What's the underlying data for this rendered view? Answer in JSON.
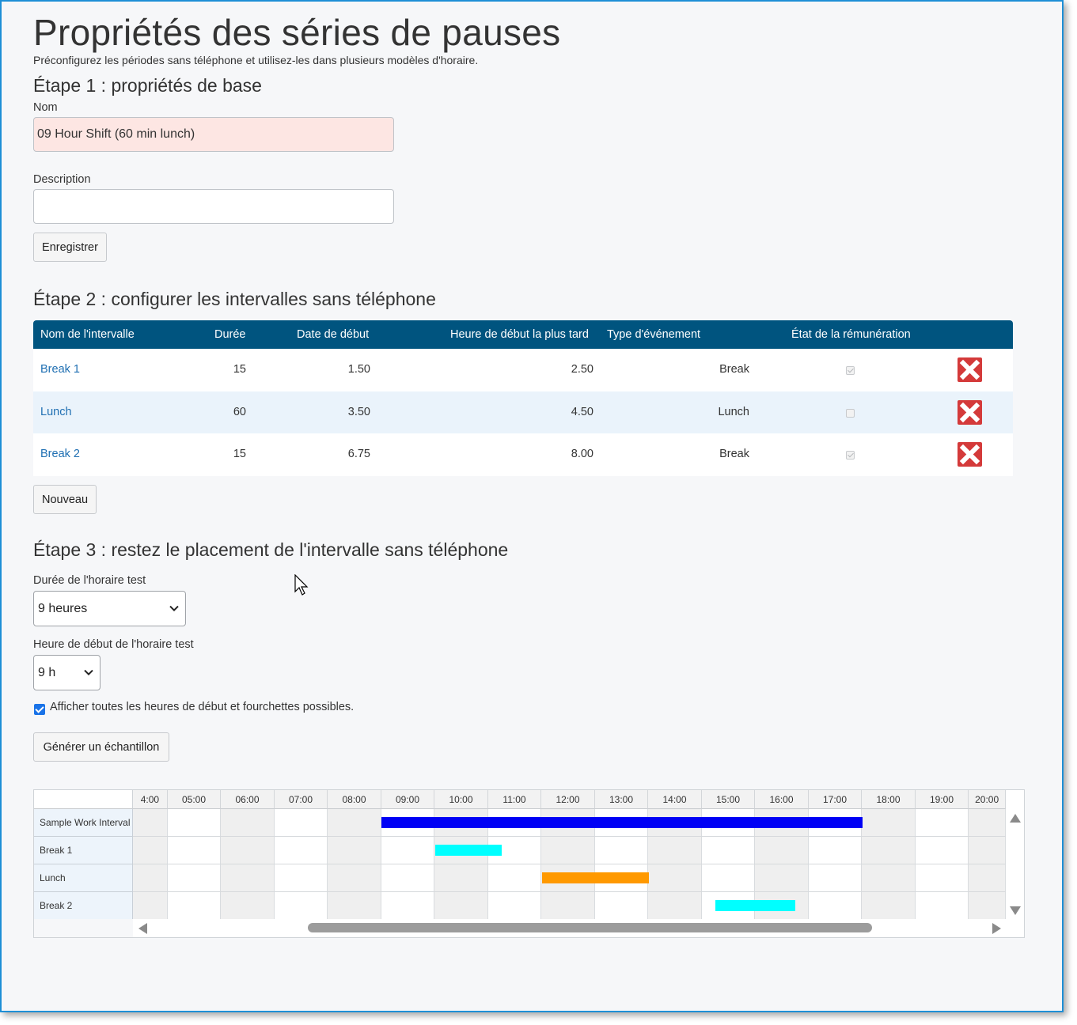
{
  "page": {
    "title": "Propriétés des séries de pauses",
    "subtitle": "Préconfigurez les périodes sans téléphone et utilisez-les dans plusieurs modèles d'horaire."
  },
  "step1": {
    "heading": "Étape 1 : propriétés de base",
    "name_label": "Nom",
    "name_value": "09 Hour Shift (60 min lunch)",
    "description_label": "Description",
    "description_value": "",
    "save_button": "Enregistrer"
  },
  "step2": {
    "heading": "Étape 2 : configurer les intervalles sans téléphone",
    "columns": {
      "name": "Nom de l'intervalle",
      "duration": "Durée",
      "start_date": "Date de début",
      "latest_start": "Heure de début la plus tard",
      "event_type": "Type d'événement",
      "pay_status": "État de la rémunération"
    },
    "rows": [
      {
        "name": "Break 1",
        "duration": "15",
        "start": "1.50",
        "latest": "2.50",
        "type": "Break",
        "paid": true
      },
      {
        "name": "Lunch",
        "duration": "60",
        "start": "3.50",
        "latest": "4.50",
        "type": "Lunch",
        "paid": false
      },
      {
        "name": "Break 2",
        "duration": "15",
        "start": "6.75",
        "latest": "8.00",
        "type": "Break",
        "paid": true
      }
    ],
    "new_button": "Nouveau"
  },
  "step3": {
    "heading": "Étape 3 : restez le placement de l'intervalle sans téléphone",
    "duration_label": "Durée de l'horaire test",
    "duration_value": "9 heures",
    "start_label": "Heure de début de l'horaire test",
    "start_value": "9 h",
    "show_all_label": "Afficher toutes les heures de début et fourchettes possibles.",
    "show_all_checked": true,
    "generate_button": "Générer un échantillon"
  },
  "gantt": {
    "hours": [
      "4:00",
      "05:00",
      "06:00",
      "07:00",
      "08:00",
      "09:00",
      "10:00",
      "11:00",
      "12:00",
      "13:00",
      "14:00",
      "15:00",
      "16:00",
      "17:00",
      "18:00",
      "19:00",
      "20:00"
    ],
    "rows": [
      "Sample Work Interval",
      "Break 1",
      "Lunch",
      "Break 2"
    ],
    "bars": [
      {
        "row": 0,
        "start_hour": 9.0,
        "end_hour": 18.0,
        "color": "#0000f5"
      },
      {
        "row": 1,
        "start_hour": 10.0,
        "end_hour": 11.25,
        "color": "#00ffff"
      },
      {
        "row": 2,
        "start_hour": 12.0,
        "end_hour": 14.0,
        "color": "#ff9900"
      },
      {
        "row": 3,
        "start_hour": 15.25,
        "end_hour": 16.75,
        "color": "#00ffff"
      }
    ],
    "colors": {
      "work": "#0000f5",
      "break": "#00ffff",
      "lunch": "#ff9900",
      "header": "#00547f"
    }
  }
}
